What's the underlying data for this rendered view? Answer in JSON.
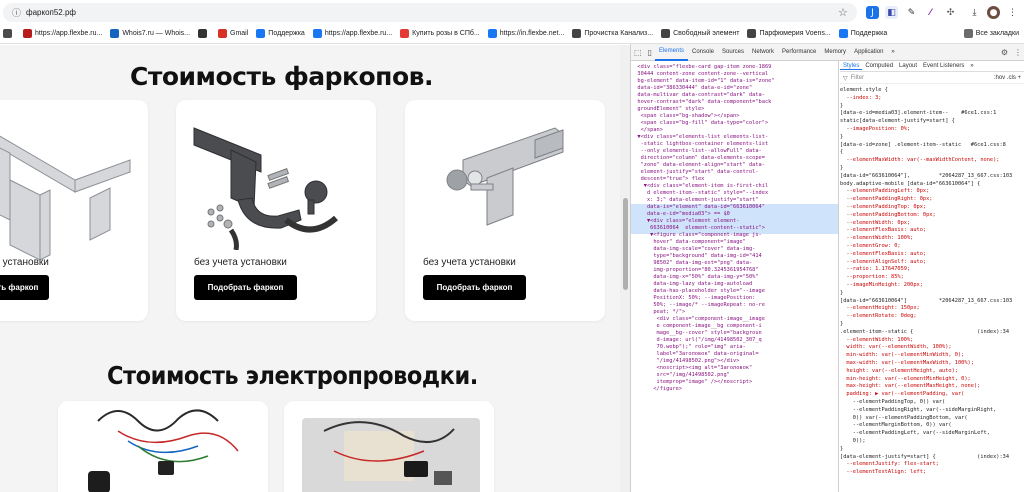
{
  "browser": {
    "url": "фаркоп52.рф",
    "bookmarks": [
      {
        "label": "",
        "color": "#4a4a4a"
      },
      {
        "label": "https://app.flexbe.ru...",
        "color": "#b71c1c"
      },
      {
        "label": "Whois7.ru — Whois...",
        "color": "#1565c0"
      },
      {
        "label": "",
        "color": "#333333"
      },
      {
        "label": "Gmail",
        "color": "#d93025"
      },
      {
        "label": "Поддержка",
        "color": "#1877f2"
      },
      {
        "label": "https://app.flexbe.ru...",
        "color": "#1877f2"
      },
      {
        "label": "Купить розы в СПб...",
        "color": "#e53935"
      },
      {
        "label": "https://in.flexbe.net...",
        "color": "#1877f2"
      },
      {
        "label": "Прочистка Канализ...",
        "color": "#444444"
      },
      {
        "label": "Свободный элемент",
        "color": "#444444"
      },
      {
        "label": "Парфюмерия Voens...",
        "color": "#444444"
      },
      {
        "label": "Поддержка",
        "color": "#1877f2"
      }
    ],
    "all_bookmarks": "Все закладки"
  },
  "page": {
    "heading_towbars": "Стоимость фаркопов.",
    "heading_wiring": "Стоимость электропроводки.",
    "cards": [
      {
        "caption": "без учета установки",
        "button": "Подобрать фаркоп"
      },
      {
        "caption": "без учета установки",
        "button": "Подобрать фаркоп"
      },
      {
        "caption": "без учета установки",
        "button": "Подобрать фаркоп"
      }
    ]
  },
  "devtools": {
    "tabs": [
      "Elements",
      "Console",
      "Sources",
      "Network",
      "Performance",
      "Memory",
      "Application",
      "»"
    ],
    "active_tab": "Elements",
    "style_tabs": [
      "Styles",
      "Computed",
      "Layout",
      "Event Listeners",
      "»"
    ],
    "filter_placeholder": "Filter",
    "filter_tools": ":hov  .cls  +",
    "element_lines": [
      "  <div class=\"flexbe-card gap-item zone-1869",
      "  30444 content-zone content-zone--vertical",
      "  bg-element\" data-item-id=\"1\" data-is=\"zone\"",
      "  data-id=\"386330444\" data-e-id=\"zone\"",
      "  data-multivar data-contrast=\"dark\" data-",
      "  hover-contrast=\"dark\" data-component=\"back",
      "  groundElement\" style>",
      "   <span class=\"bg-shadow\"></span>",
      "   <span class=\"bg-fill\" data-type=\"color\">",
      "   </span>",
      "  ▼<div class=\"elements-list elements-list-",
      "   -static lightbox-container elements-list",
      "   --only elements-list--allowFull\" data-",
      "   direction=\"column\" data-elements-scope=",
      "   \"zone\" data-element-align=\"start\" data-",
      "   element-justify=\"start\" data-control-",
      "   descent=\"true\"> flex",
      "    ▼<div class=\"element-item is-first-chil",
      "     d element-item--static\" style=\"--index",
      "     x: 3;\" data-element-justify=\"start\"",
      "     data-is=\"element\" data-id=\"663610064\"",
      "     data-e-id=\"media03\"> == $0",
      "     ▼<div class=\"element element-",
      "      663610064  element-content--static\">",
      "      ▼<figure class=\"component-image js-",
      "       hover\" data-component=\"image\"",
      "       data-img-scale=\"cover\" data-img-",
      "       type=\"background\" data-img-id=\"414",
      "       98502\" data-img-ext=\"png\" data-",
      "       img-proportion=\"80.3245361954768\"",
      "       data-img-x=\"50%\" data-img-y=\"50%\"",
      "       data-img-lazy data-img-autoload",
      "       data-has-placeholder style=\"--image",
      "       PositionX: 50%; --imagePosition:",
      "       50%; --image/* --imageRepeat: no-re",
      "       peat; */\">",
      "        <div class=\"component-image__image",
      "        e component-image__bg component-i",
      "        mage__bg--cover\" style=\"backgroun",
      "        d-image: url(\"/img/41498502_307_q",
      "        70.webp\");\" role=\"img\" aria-",
      "        label=\"Заголовок\" data-original=",
      "        \"/img/41498502.png\"></div>",
      "        <noscript><img alt=\"Заголовок\"",
      "        src=\"/img/41498502.png\"",
      "        itemprop=\"image\" /></noscript>",
      "       </figure>"
    ],
    "style_lines": [
      "element.style {",
      "  --index: 3;",
      "}",
      "[data-e-id=media03].element-item--    #6ce1.css:1",
      "static[data-element-justify=start] {",
      "  --imagePosition: 0%;",
      "}",
      "[data-e-id=zone] .element-item--static   #6ce1.css:8",
      "{",
      "  --elementMaxWidth: var(--maxWidthContent, none);",
      "}",
      "[data-id=\"663610064\"],         *2064287_13_667.css:103",
      "body.adaptive-mobile [data-id=\"663610064\"] {",
      "  --elementPaddingLeft: 0px;",
      "  --elementPaddingRight: 0px;",
      "  --elementPaddingTop: 0px;",
      "  --elementPaddingBottom: 0px;",
      "  --elementWidth: 0px;",
      "  --elementFlexBasis: auto;",
      "  --elementWidth: 100%;",
      "  --elementGrow: 0;",
      "  --elementFlexBasis: auto;",
      "  --elementAlignSelf: auto;",
      "  --ratio: 1.17647059;",
      "  --proportion: 85%;",
      "  --imageMinHeight: 200px;",
      "}",
      "[data-id=\"663610064\"]          *2064287_13_667.css:103",
      "  --elementHeight: 150px;",
      "  --elementRotate: 0deg;",
      "}",
      ".element-item--static {                    (index):34",
      "  --elementWidth: 100%;",
      "  width: var(--elementWidth, 100%);",
      "  min-width: var(--elementMinWidth, 0);",
      "  max-width: var(--elementMaxWidth, 100%);",
      "  height: var(--elementHeight, auto);",
      "  min-height: var(--elementMinHeight, 0);",
      "  max-height: var(--elementMaxHeight, none);",
      "  padding: ▶ var(--elementPadding, var(",
      "    --elementPaddingTop, 0)) var(",
      "    --elementPaddingRight, var(--sideMarginRight,",
      "    0)) var(--elementPaddingBottom, var(",
      "    --elementMarginBottom, 0)) var(",
      "    --elementPaddingLeft, var(--sideMarginLeft,",
      "    0));",
      "}",
      "[data-element-justify=start] {             (index):34",
      "  --elementJustify: flex-start;",
      "  --elementTextAlign: left;"
    ]
  }
}
